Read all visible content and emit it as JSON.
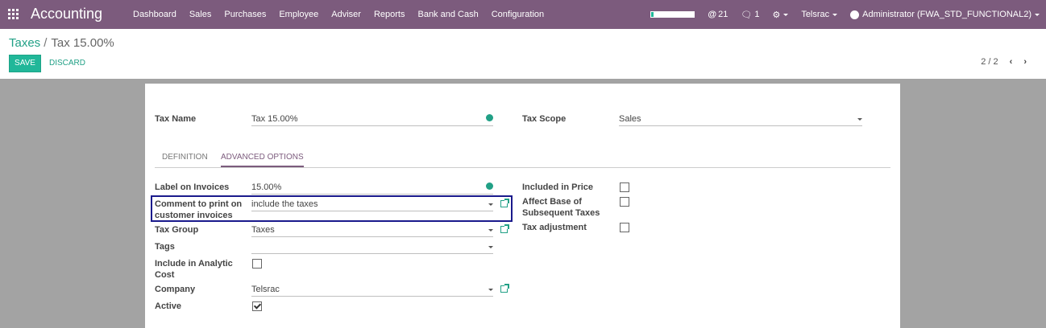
{
  "navbar": {
    "app_title": "Accounting",
    "menu": [
      "Dashboard",
      "Sales",
      "Purchases",
      "Employee",
      "Adviser",
      "Reports",
      "Bank and Cash",
      "Configuration"
    ],
    "mentions_count": "21",
    "messages_count": "1",
    "company": "Telsrac",
    "user": "Administrator (FWA_STD_FUNCTIONAL2)",
    "progress_fraction": 0.05
  },
  "breadcrumb": {
    "parent": "Taxes",
    "separator": "/",
    "current": "Tax 15.00%"
  },
  "buttons": {
    "save": "SAVE",
    "discard": "DISCARD"
  },
  "pager": {
    "value": "2 / 2",
    "prev": "‹",
    "next": "›"
  },
  "form": {
    "tax_name_label": "Tax Name",
    "tax_name_value": "Tax 15.00%",
    "tax_scope_label": "Tax Scope",
    "tax_scope_value": "Sales",
    "tabs": [
      "DEFINITION",
      "ADVANCED OPTIONS"
    ],
    "label_on_invoices_label": "Label on Invoices",
    "label_on_invoices_value": "15.00%",
    "comment_label": "Comment to print on customer invoices",
    "comment_value": "include the taxes",
    "tax_group_label": "Tax Group",
    "tax_group_value": "Taxes",
    "tags_label": "Tags",
    "tags_value": "",
    "analytic_label": "Include in Analytic Cost",
    "analytic_checked": false,
    "company_label": "Company",
    "company_value": "Telsrac",
    "active_label": "Active",
    "active_checked": true,
    "included_price_label": "Included in Price",
    "included_price_checked": false,
    "affect_base_label": "Affect Base of Subsequent Taxes",
    "affect_base_checked": false,
    "tax_adjustment_label": "Tax adjustment",
    "tax_adjustment_checked": false
  }
}
